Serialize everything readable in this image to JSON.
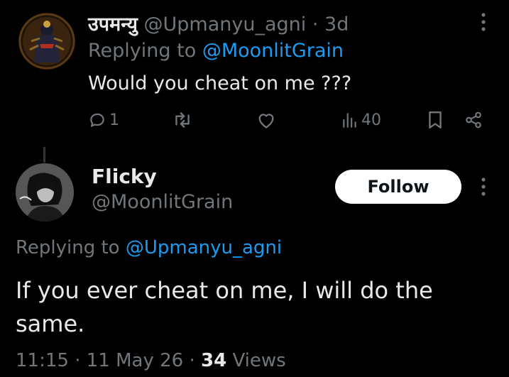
{
  "parent_tweet": {
    "display_name": "उपमन्यु",
    "handle": "@Upmanyu_agni",
    "separator": "·",
    "age": "3d",
    "replying_prefix": "Replying to",
    "replying_handle": "@MoonlitGrain",
    "text": "Would you cheat on me ???",
    "actions": {
      "reply_count": "1",
      "views_count": "40"
    },
    "icons": [
      "comment-icon",
      "retweet-icon",
      "heart-icon",
      "views-icon",
      "bookmark-icon",
      "share-icon",
      "more-icon"
    ]
  },
  "main_tweet": {
    "display_name": "Flicky",
    "handle": "@MoonlitGrain",
    "follow_label": "Follow",
    "replying_prefix": "Replying to",
    "replying_handle": "@Upmanyu_agni",
    "text": "If you ever cheat on me, I will do the same.",
    "time": "11:15",
    "sep1": "·",
    "date": "11 May 26",
    "sep2": "·",
    "views": "34",
    "views_label": "Views"
  },
  "colors": {
    "background": "#000000",
    "primary_text": "#e7e9ea",
    "secondary_text": "#71767b",
    "link": "#1d9bf0",
    "follow_button_bg": "#ffffff"
  }
}
